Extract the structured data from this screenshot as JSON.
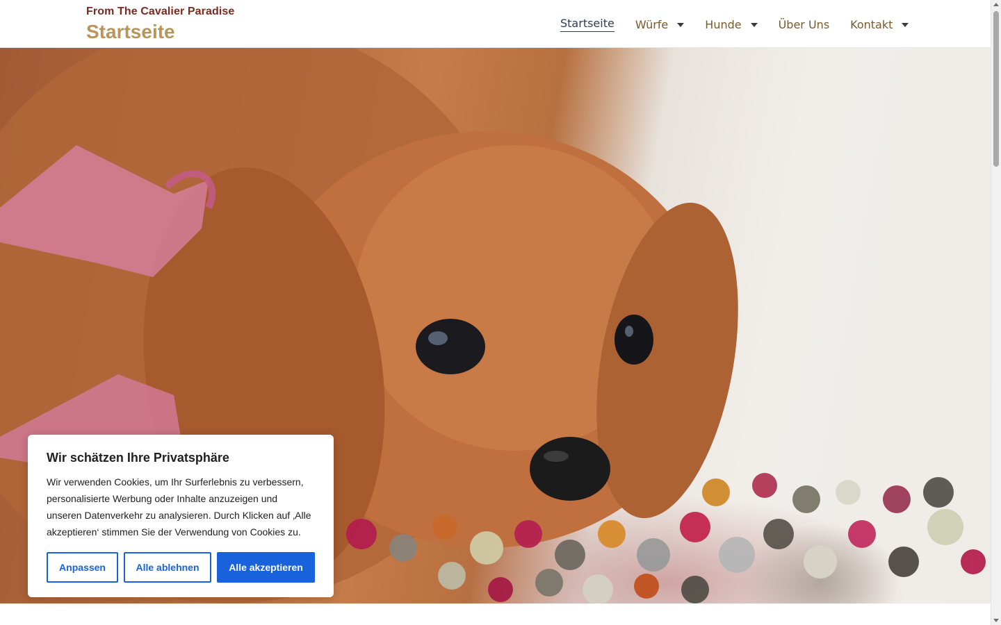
{
  "header": {
    "tagline": "From The Cavalier Paradise",
    "title": "Startseite",
    "nav": [
      {
        "label": "Startseite",
        "active": true,
        "has_dropdown": false
      },
      {
        "label": "Würfe",
        "active": false,
        "has_dropdown": true
      },
      {
        "label": "Hunde",
        "active": false,
        "has_dropdown": true
      },
      {
        "label": "Über Uns",
        "active": false,
        "has_dropdown": false
      },
      {
        "label": "Kontakt",
        "active": false,
        "has_dropdown": true
      }
    ]
  },
  "hero": {
    "icon": "hero-dog-image"
  },
  "cookie_banner": {
    "title": "Wir schätzen Ihre Privatsphäre",
    "text": "Wir verwenden Cookies, um Ihr Surferlebnis zu verbessern, personalisierte Werbung oder Inhalte anzuzeigen und unseren Datenverkehr zu analysieren. Durch Klicken auf ‚Alle akzeptieren‘ stimmen Sie der Verwendung von Cookies zu.",
    "buttons": {
      "customize": "Anpassen",
      "reject": "Alle ablehnen",
      "accept": "Alle akzeptieren"
    }
  },
  "colors": {
    "accent": "#1863dc",
    "brand_tagline": "#7a2a1e",
    "brand_title": "#b8955a",
    "nav_text": "#7a5a2c",
    "nav_active": "#2d3e50"
  }
}
